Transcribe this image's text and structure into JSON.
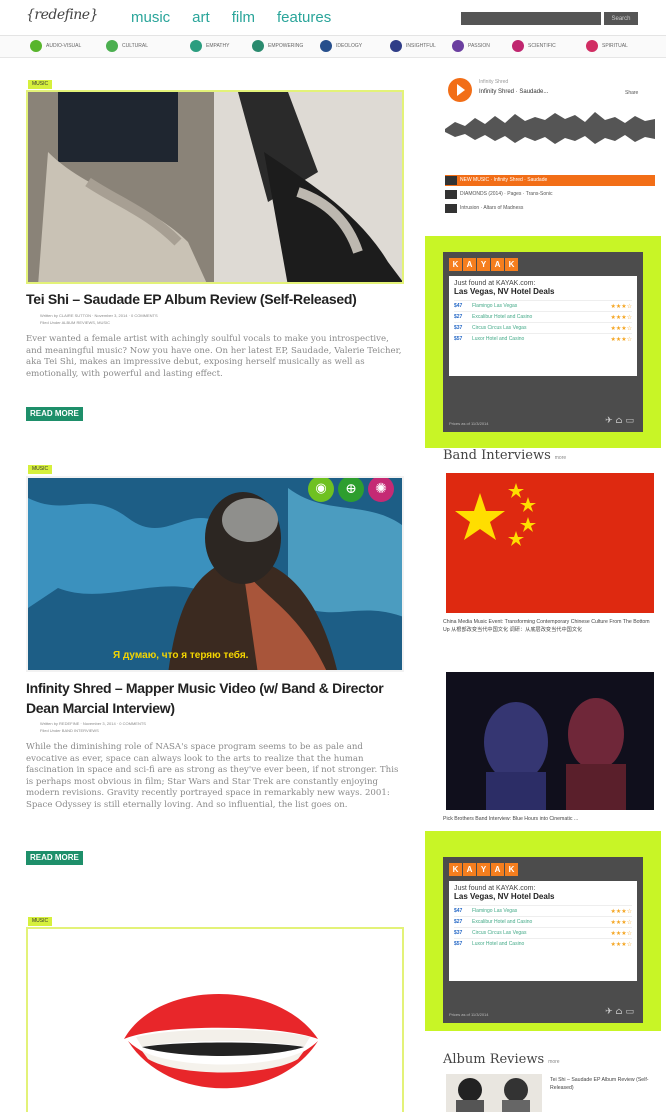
{
  "header": {
    "logo": "{redefine}",
    "nav": [
      "music",
      "art",
      "film",
      "features"
    ],
    "search_button": "Search"
  },
  "categories": [
    {
      "label": "AUDIO-VISUAL",
      "color": "#58b52c"
    },
    {
      "label": "CULTURAL",
      "color": "#4caf50"
    },
    {
      "label": "EMPATHY",
      "color": "#2b9d7f"
    },
    {
      "label": "EMPOWERING",
      "color": "#2a8a6e"
    },
    {
      "label": "IDEOLOGY",
      "color": "#274f8c"
    },
    {
      "label": "INSIGHTFUL",
      "color": "#2f3d87"
    },
    {
      "label": "PASSION",
      "color": "#6b3fa0"
    },
    {
      "label": "SCIENTIFIC",
      "color": "#c0266f"
    },
    {
      "label": "SPIRITUAL",
      "color": "#d12d63"
    }
  ],
  "posts": [
    {
      "tag": "MUSIC",
      "title": "Tei Shi – Saudade EP Album Review (Self-Released)",
      "meta1": "Written by CLAIRE SUTTON · November 3, 2014 · 0 COMMENTS",
      "meta2": "Filed Under ALBUM REVIEWS, MUSIC",
      "excerpt": "Ever wanted a female artist with achingly soulful vocals to make you introspective, and meaningful music? Now you have one. On her latest EP, Saudade, Valerie Teicher, aka Tei Shi, makes an impressive debut, exposing herself musically as well as emotionally, with powerful and lasting effect.",
      "read_more": "READ MORE"
    },
    {
      "tag": "MUSIC",
      "title": "Infinity Shred – Mapper Music Video (w/ Band & Director Dean Marcial Interview)",
      "meta1": "Written by REDEFINE · November 3, 2014 · 0 COMMENTS",
      "meta2": "Filed Under BAND INTERVIEWS",
      "subtitle": "Я думаю, что я теряю тебя.",
      "excerpt": "While the diminishing role of NASA's space program seems to be as pale and evocative as ever, space can always look to the arts to realize that the human fascination in space and sci-fi are as strong as they've ever been, if not stronger. This is perhaps most obvious in film; Star Wars and Star Trek are constantly enjoying modern revisions. Gravity recently portrayed space in remarkably new ways. 2001: Space Odyssey is still eternally loving. And so influential, the list goes on.",
      "read_more": "READ MORE"
    },
    {
      "tag": "MUSIC"
    }
  ],
  "player": {
    "artist": "Infinity Shred",
    "track": "Infinity Shred · Saudade...",
    "share": "Share",
    "tracks": [
      "NEW MUSIC · Infinity Shred · Saudade",
      "DIAMONDS (2014) · Pages · Trans-Sonic",
      "Intrusion · Altars of Madness"
    ]
  },
  "ad": {
    "brand": [
      "K",
      "A",
      "Y",
      "A",
      "K"
    ],
    "line1": "Just found at KAYAK.com:",
    "line2": "Las Vegas, NV Hotel Deals",
    "hotels": [
      {
        "price": "$47",
        "name": "Flamingo Las Vegas"
      },
      {
        "price": "$27",
        "name": "Excalibur Hotel and Casino"
      },
      {
        "price": "$37",
        "name": "Circus Circus Las Vegas"
      },
      {
        "price": "$57",
        "name": "Luxor Hotel and Casino"
      }
    ],
    "footer": "Prices as of 11/3/2014"
  },
  "sidebar": {
    "band_interviews": "Band Interviews",
    "more": "more",
    "interview1_caption": "China Media Music Event: Transforming Contemporary Chinese Culture From The Bottom Up 从根部改变当代中国文化  调研：从底层改变当代中国文化",
    "interview2_caption": "Pick Brothers Band Interview: Blue Hours into Cinematic ...",
    "album_reviews": "Album Reviews",
    "album1_caption": "Tei Shi – Saudade EP Album Review (Self-Released)"
  }
}
